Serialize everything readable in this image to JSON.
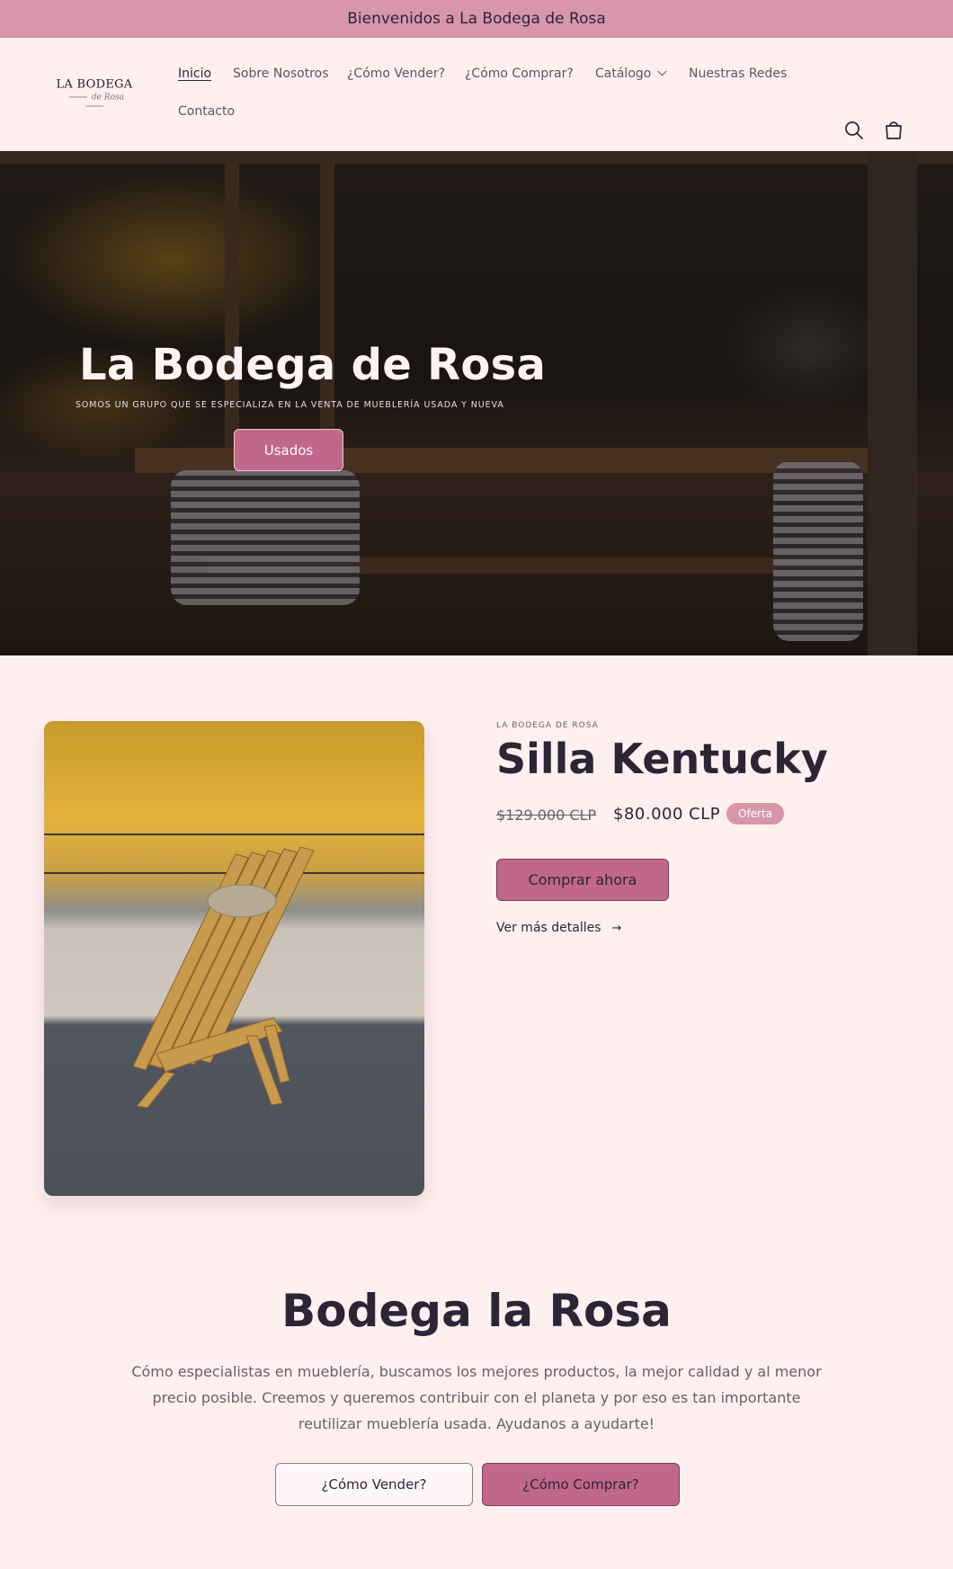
{
  "announcement": {
    "text": "Bienvenidos a La Bodega de Rosa"
  },
  "logo": {
    "line1": "LA BODEGA",
    "line2": "de Rosa"
  },
  "nav": {
    "items": [
      {
        "label": "Inicio"
      },
      {
        "label": "Sobre Nosotros"
      },
      {
        "label": "¿Cómo Vender?"
      },
      {
        "label": "¿Cómo Comprar?"
      },
      {
        "label": "Catálogo"
      },
      {
        "label": "Nuestras Redes"
      },
      {
        "label": "Contacto"
      }
    ]
  },
  "icons": {
    "search": "search-icon",
    "cart": "cart-icon"
  },
  "hero": {
    "title": "La Bodega de Rosa",
    "subtitle": "SOMOS UN GRUPO QUE SE ESPECIALIZA EN LA VENTA DE MUEBLERÍA USADA Y NUEVA",
    "button": "Usados"
  },
  "product": {
    "vendor": "LA BODEGA DE ROSA",
    "title": "Silla Kentucky",
    "price_old": "$129.000 CLP",
    "price_new": "$80.000 CLP",
    "badge": "Oferta",
    "buy_button": "Comprar ahora",
    "details_link": "Ver más detalles"
  },
  "about": {
    "title": "Bodega la Rosa",
    "text": "Cómo especialistas en mueblería, buscamos los mejores productos, la mejor calidad y al menor precio posible. Creemos y queremos contribuir con el planeta y por eso es tan importante reutilizar mueblería usada. Ayudanos a ayudarte!",
    "button_sell": "¿Cómo Vender?",
    "button_buy": "¿Cómo Comprar?"
  },
  "colors": {
    "accent": "#c0678a",
    "announcement_bg": "#d796aa",
    "page_bg": "#fff0f0",
    "text": "#2b2536"
  }
}
